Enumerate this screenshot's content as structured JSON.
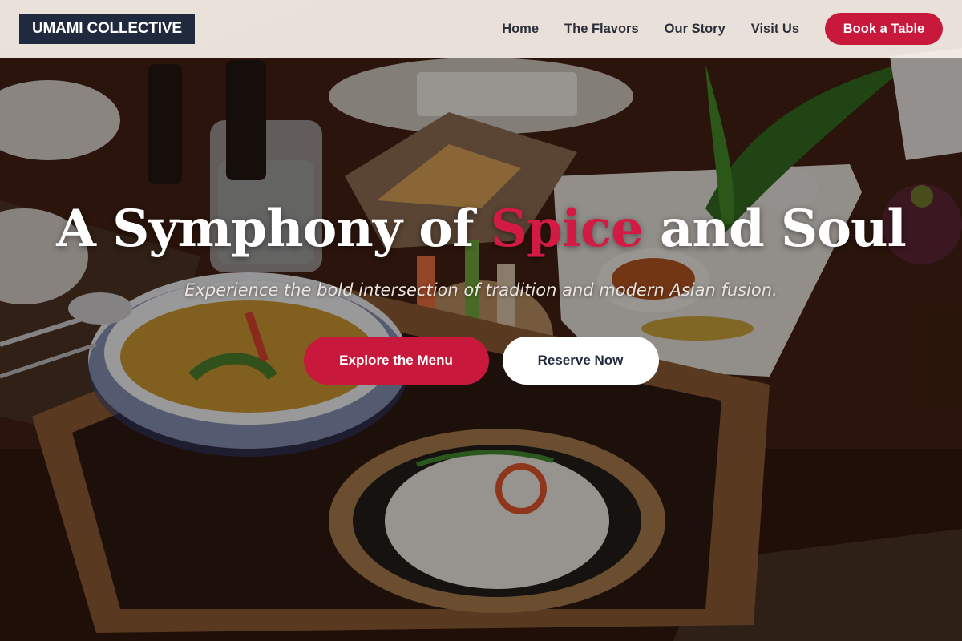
{
  "brand": {
    "logo_text": "UMAMI COLLECTIVE"
  },
  "nav": {
    "items": [
      {
        "label": "Home"
      },
      {
        "label": "The Flavors"
      },
      {
        "label": "Our Story"
      },
      {
        "label": "Visit Us"
      }
    ],
    "cta_label": "Book a Table"
  },
  "hero": {
    "headline_start": "A Symphony of ",
    "headline_accent": "Spice",
    "headline_end": " and Soul",
    "tagline": "Experience the bold intersection of tradition and modern Asian fusion.",
    "primary_cta": "Explore the Menu",
    "secondary_cta": "Reserve Now",
    "background_image": "asian-food-table-photo"
  },
  "colors": {
    "accent": "#c8183c",
    "header_bg": "#f7f0eb",
    "logo_bg": "#1f2a3e",
    "nav_text": "#2b2f3a"
  }
}
